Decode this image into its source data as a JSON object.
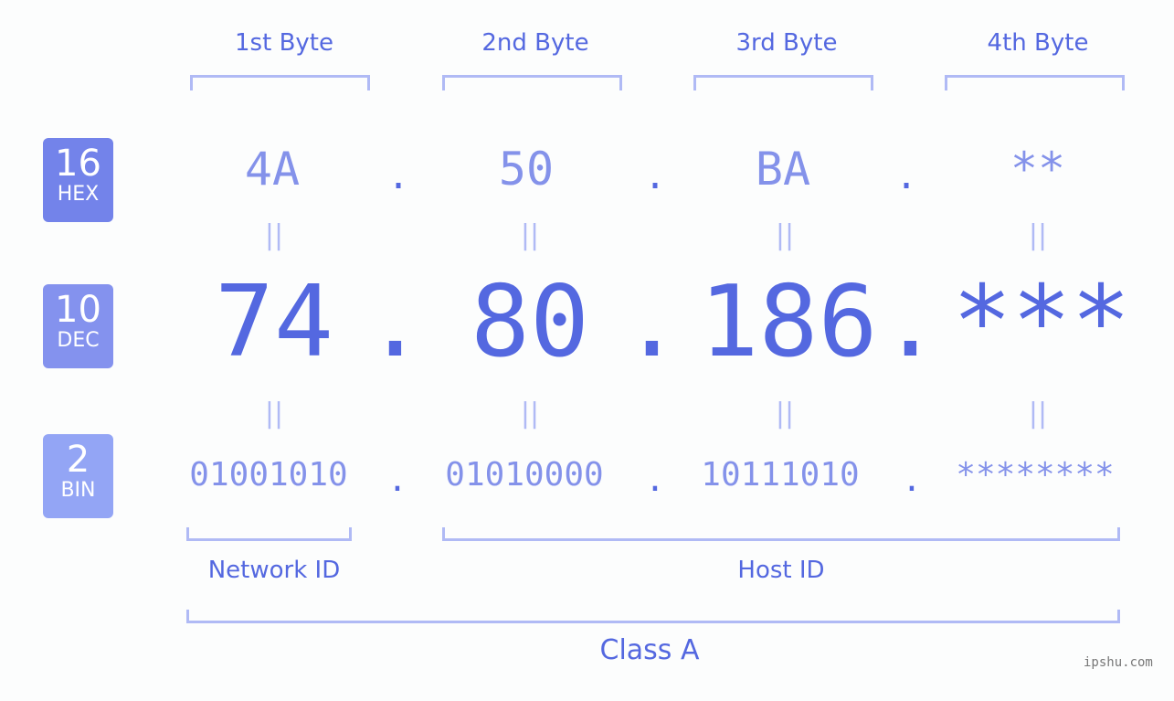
{
  "headers": [
    "1st Byte",
    "2nd Byte",
    "3rd Byte",
    "4th Byte"
  ],
  "badges": [
    {
      "num": "16",
      "label": "HEX",
      "color": "#7383ea"
    },
    {
      "num": "10",
      "label": "DEC",
      "color": "#8492ee"
    },
    {
      "num": "2",
      "label": "BIN",
      "color": "#93a5f5"
    }
  ],
  "hex": [
    "4A",
    "50",
    "BA",
    "**"
  ],
  "dec": [
    "74",
    "80",
    "186",
    "***"
  ],
  "bin": [
    "01001010",
    "01010000",
    "10111010",
    "********"
  ],
  "separator": ".",
  "equals": "=",
  "network_id": "Network ID",
  "host_id": "Host ID",
  "class_label": "Class A",
  "watermark": "ipshu.com"
}
